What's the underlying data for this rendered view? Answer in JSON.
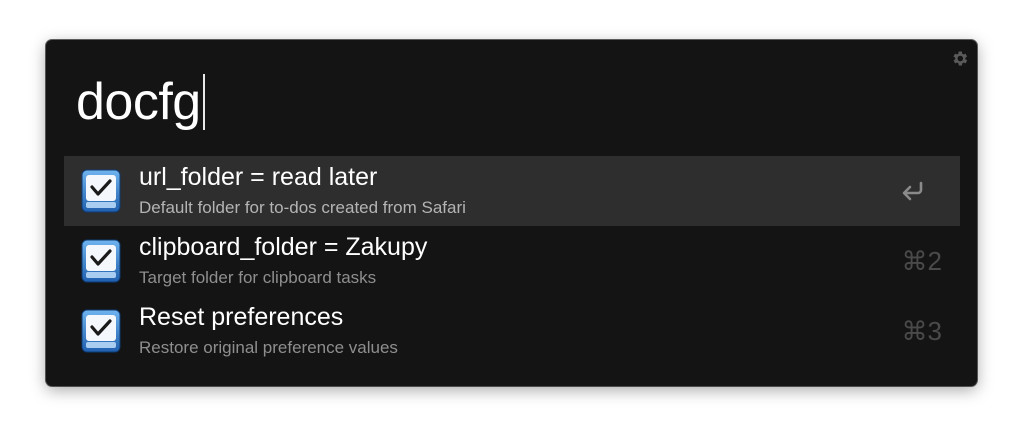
{
  "search": {
    "query": "docfg"
  },
  "settings": {
    "icon": "gear-icon"
  },
  "results": [
    {
      "title": "url_folder = read later",
      "subtitle": "Default folder for to-dos created from Safari",
      "shortcut_icon": "return-icon",
      "icon": "things-app-icon",
      "selected": true
    },
    {
      "title": "clipboard_folder = Zakupy",
      "subtitle": "Target folder for clipboard tasks",
      "shortcut": "⌘2",
      "icon": "things-app-icon",
      "selected": false
    },
    {
      "title": "Reset preferences",
      "subtitle": "Restore original preference values",
      "shortcut": "⌘3",
      "icon": "things-app-icon",
      "selected": false
    }
  ],
  "colors": {
    "window_background": "#141414",
    "selected_row": "#2e2e2e",
    "text_primary": "#ffffff",
    "text_secondary": "#8e8e8e",
    "shortcut_text": "#4a4a4a"
  }
}
